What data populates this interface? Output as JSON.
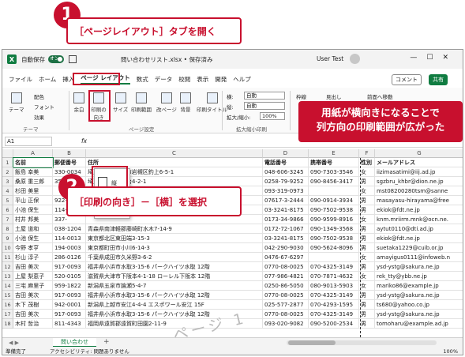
{
  "callouts": {
    "step1_number": "1",
    "step1_text": "［ページレイアウト］タブを開く",
    "step2_number": "2",
    "step2_text": "［印刷の向き］－［横］を選択",
    "note_line1": "用紙が横向きになることで",
    "note_line2": "列方向の印刷範囲が広がった"
  },
  "titlebar": {
    "app_icon": "X",
    "autosave_label": "自動保存",
    "autosave_state": "オン",
    "document_title": "問い合わせリスト.xlsx • 保存済み",
    "user_name": "User Test",
    "window_controls": "—☐✕"
  },
  "menu": {
    "tabs": [
      "ファイル",
      "ホーム",
      "挿入",
      "ページ レイアウト",
      "数式",
      "データ",
      "校閲",
      "表示",
      "開発",
      "ヘルプ"
    ],
    "comment_label": "コメント",
    "share_label": "共有"
  },
  "ribbon": {
    "theme_label": "テーマ",
    "color_label": "配色",
    "font_label": "フォント",
    "effect_label": "効果",
    "margin_label": "余白",
    "orientation_label": "印刷の向き",
    "size_label": "サイズ",
    "print_area_label": "印刷範囲",
    "breaks_label": "改ページ",
    "background_label": "背景",
    "print_titles_label": "印刷タイトル",
    "page_setup_group": "ページ設定",
    "width_label": "横:",
    "height_label": "縦:",
    "scale_label": "拡大/縮小:",
    "width_value": "自動",
    "height_value": "自動",
    "scale_value": "100%",
    "fit_group": "拡大縮小印刷",
    "gridlines_label": "枠線",
    "headings_label": "見出し",
    "bring_forward_label": "前面へ移動",
    "theme_group": "テーマ"
  },
  "formula_bar": {
    "name_box": "A1",
    "fx_label": "fx"
  },
  "orientation_menu": {
    "portrait": "縦",
    "landscape": "横"
  },
  "sheet": {
    "columns": [
      "A",
      "B",
      "C",
      "D",
      "E",
      "F",
      "G"
    ],
    "header_row": [
      "名前",
      "郵便番号",
      "住所",
      "電話番号",
      "携帯番号",
      "性別",
      "メールアドレス"
    ],
    "rows": [
      [
        "飯島 幸美",
        "330-0034",
        "埼玉県さいたま市岩槻区釣上6-5-1",
        "048-606-3245",
        "090-7303-3546",
        "女",
        "iizimasatimi@iij.ad.jp"
      ],
      [
        "桑原 重三郎",
        "350-0802",
        "埼玉県川越市中台4-2-1",
        "0258-79-9252",
        "090-8456-3417",
        "男",
        "sgzbru_khbr@dion.ne.jp"
      ],
      [
        "杉田 美里",
        "",
        "",
        "093-319-0973",
        "",
        "女",
        "mst08200280tsm@sanne"
      ],
      [
        "平山 正保",
        "922-",
        "",
        "07617-3-2444",
        "090-0914-3934",
        "男",
        "masayasu-hirayama@free"
      ],
      [
        "小池 保生",
        "114-",
        "",
        "03-3241-8175",
        "090-7502-9538",
        "男",
        "ekiok@fdt.ne.jp"
      ],
      [
        "村井 邦美",
        "337-",
        "",
        "0173-34-9866",
        "090-9599-8916",
        "女",
        "knm.mriirm.mnk@ocn.ne."
      ],
      [
        "土屋 道和",
        "038-1204",
        "青森県南津軽郡藤崎町水木7-14-9",
        "0172-72-1067",
        "090-1349-3568",
        "男",
        "aytut0110@dti.ad.jp"
      ],
      [
        "小池 保生",
        "114-0013",
        "東京都北区東田端3-15-3",
        "03-3241-8175",
        "090-7502-9538",
        "男",
        "ekiok@fdt.ne.jp"
      ],
      [
        "今野 孝亨",
        "194-0003",
        "東京都町田市小川6-14-3",
        "042-290-9030",
        "090-5624-8096",
        "男",
        "suetaka1229@cuib.or.jp"
      ],
      [
        "杉山 淳子",
        "286-0126",
        "千葉県成田市久米野3-6-2",
        "0476-67-6297",
        "",
        "女",
        "amayigus0111@infoweb.n"
      ],
      [
        "吉田 美次",
        "917-0093",
        "福井県小浜市水取3-15-6 パークハイツ水取 12階",
        "0770-08-0025",
        "070-4325-3149",
        "男",
        "ysd-ystg@sakura.ne.jp"
      ],
      [
        "上屋 梨恵子",
        "520-0105",
        "滋賀県大津市下阪本4-1-18 ローレル下阪本 12階",
        "077-986-4821",
        "070-7871-4632",
        "女",
        "rek_tty@ybb.ne.jp"
      ],
      [
        "三宅 麻里子",
        "959-1822",
        "新潟県五泉市論瀬5-4-7",
        "0250-86-5050",
        "080-9013-5903",
        "女",
        "mariko86@example.jp"
      ],
      [
        "吉田 美次",
        "917-0093",
        "福井県小浜市水取3-15-6 パークハイツ水取 12階",
        "0770-08-0025",
        "070-4325-3149",
        "男",
        "ysd-ystg@sakura.ne.jp"
      ],
      [
        "木下 茂樹",
        "942-0001",
        "新潟県上越市安江4-4-4 エスポワール安江 15F",
        "025-577-2877",
        "070-4293-1595",
        "男",
        "ts680@yahoo.co.jp"
      ],
      [
        "吉田 美次",
        "917-0093",
        "福井県小浜市水取3-15-6 パークハイツ水取 12階",
        "0770-08-0025",
        "070-4325-3149",
        "男",
        "ysd-ystg@sakura.ne.jp"
      ],
      [
        "木村 哲治",
        "811-4343",
        "福岡県遠賀郡遠賀町田園2-11-9",
        "093-020-9082",
        "090-5200-2534",
        "男",
        "tomoharu@example.ad.jp"
      ]
    ]
  },
  "sheet_tabs": {
    "active": "問い合わせ",
    "add": "+",
    "nav": "◀ ▶"
  },
  "status": {
    "ready": "準備完了",
    "accessibility": "アクセシビリティ: 問題ありません",
    "zoom": "100%"
  },
  "watermark": "ページ 1"
}
